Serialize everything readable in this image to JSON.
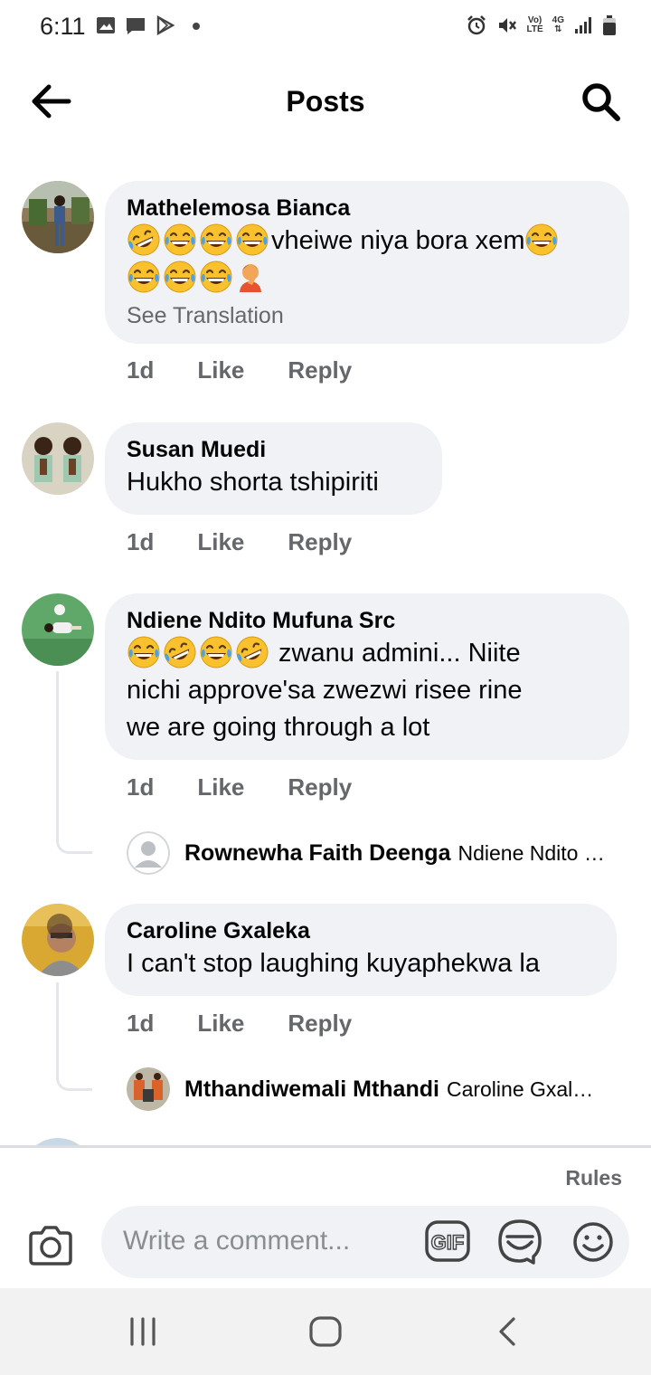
{
  "status_bar": {
    "time": "6:11",
    "left_icons": [
      "image-icon",
      "message-icon",
      "play-store-icon",
      "dot-icon"
    ],
    "right_icons": [
      "alarm-icon",
      "mute-icon",
      "volte-icon",
      "4g-icon",
      "signal-icon",
      "battery-icon"
    ],
    "volte_label_top": "Vo)",
    "volte_label_bottom": "LTE",
    "network_label": "4G"
  },
  "header": {
    "title": "Posts",
    "back_icon": "arrow-left-icon",
    "search_icon": "search-icon"
  },
  "comments": [
    {
      "author": "Mathelemosa Bianca",
      "text_line1": "vheiwe niya bora xem",
      "see_translation": "See Translation",
      "time": "1d",
      "like": "Like",
      "reply": "Reply"
    },
    {
      "author": "Susan Muedi",
      "text": "Hukho shorta tshipiriti",
      "time": "1d",
      "like": "Like",
      "reply": "Reply"
    },
    {
      "author": "Ndiene Ndito Mufuna Src",
      "text_line1": " zwanu admini... Niite",
      "text_line2": "nichi approve'sa zwezwi risee rine",
      "text_line3": "we are going through a lot",
      "time": "1d",
      "like": "Like",
      "reply": "Reply",
      "reply_preview": {
        "author": "Rownewha Faith Deenga",
        "text": "Ndiene Ndito Mufuna Src"
      }
    },
    {
      "author": "Caroline Gxaleka",
      "text": "I can't stop laughing kuyaphekwa la",
      "time": "1d",
      "like": "Like",
      "reply": "Reply",
      "reply_preview": {
        "author": "Mthandiwemali Mthandi",
        "text": "Caroline Gxaleka"
      }
    }
  ],
  "composer": {
    "rules": "Rules",
    "placeholder": "Write a comment...",
    "gif_label": "GIF",
    "camera_icon": "camera-icon",
    "sticker_icon": "sticker-icon",
    "emoji_icon": "smiley-icon"
  },
  "nav_bar": {
    "icons": [
      "recents-icon",
      "home-icon",
      "back-icon"
    ]
  },
  "colors": {
    "bubble": "#f0f2f5",
    "secondary_text": "#65676b",
    "primary_text": "#050505"
  }
}
